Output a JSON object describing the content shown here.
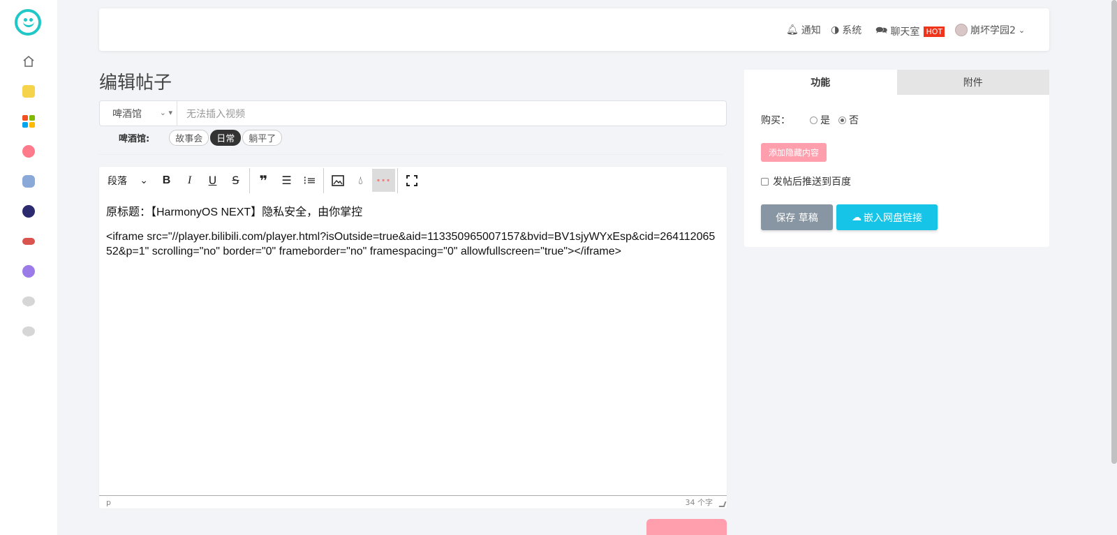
{
  "header": {
    "notify": "通知",
    "system": "系统",
    "chat": "聊天室",
    "hot_badge": "HOT",
    "username": "崩坏学园2"
  },
  "page": {
    "title": "编辑帖子"
  },
  "category": {
    "selected": "啤酒馆",
    "input_placeholder": "无法插入视频",
    "tag_label": "啤酒馆:",
    "tags": [
      "故事会",
      "日常",
      "躺平了"
    ],
    "active_tag": "日常"
  },
  "editor": {
    "paragraph_select": "段落",
    "content": [
      "原标题：【HarmonyOS NEXT】隐私安全，由你掌控",
      "<iframe src=\"//player.bilibili.com/player.html?isOutside=true&aid=113350965007157&bvid=BV1sjyWYxEsp&cid=26411206552&p=1\" scrolling=\"no\" border=\"0\" frameborder=\"no\" framespacing=\"0\" allowfullscreen=\"true\"></iframe>"
    ],
    "status_path": "p",
    "word_count": "34 个字"
  },
  "panel": {
    "tabs": [
      "功能",
      "附件"
    ],
    "buy_label": "购买：",
    "buy_yes": "是",
    "buy_no": "否",
    "buy_selected": "否",
    "add_hidden": "添加隐藏内容",
    "push_baidu": "发帖后推送到百度",
    "save_draft": "保存 草稿",
    "embed_link": "嵌入网盘链接"
  },
  "colors": {
    "accent_cyan": "#16c4e8",
    "pink": "#ff9fae",
    "hot_red": "#f0341c",
    "logo": "#1fc7c7"
  }
}
